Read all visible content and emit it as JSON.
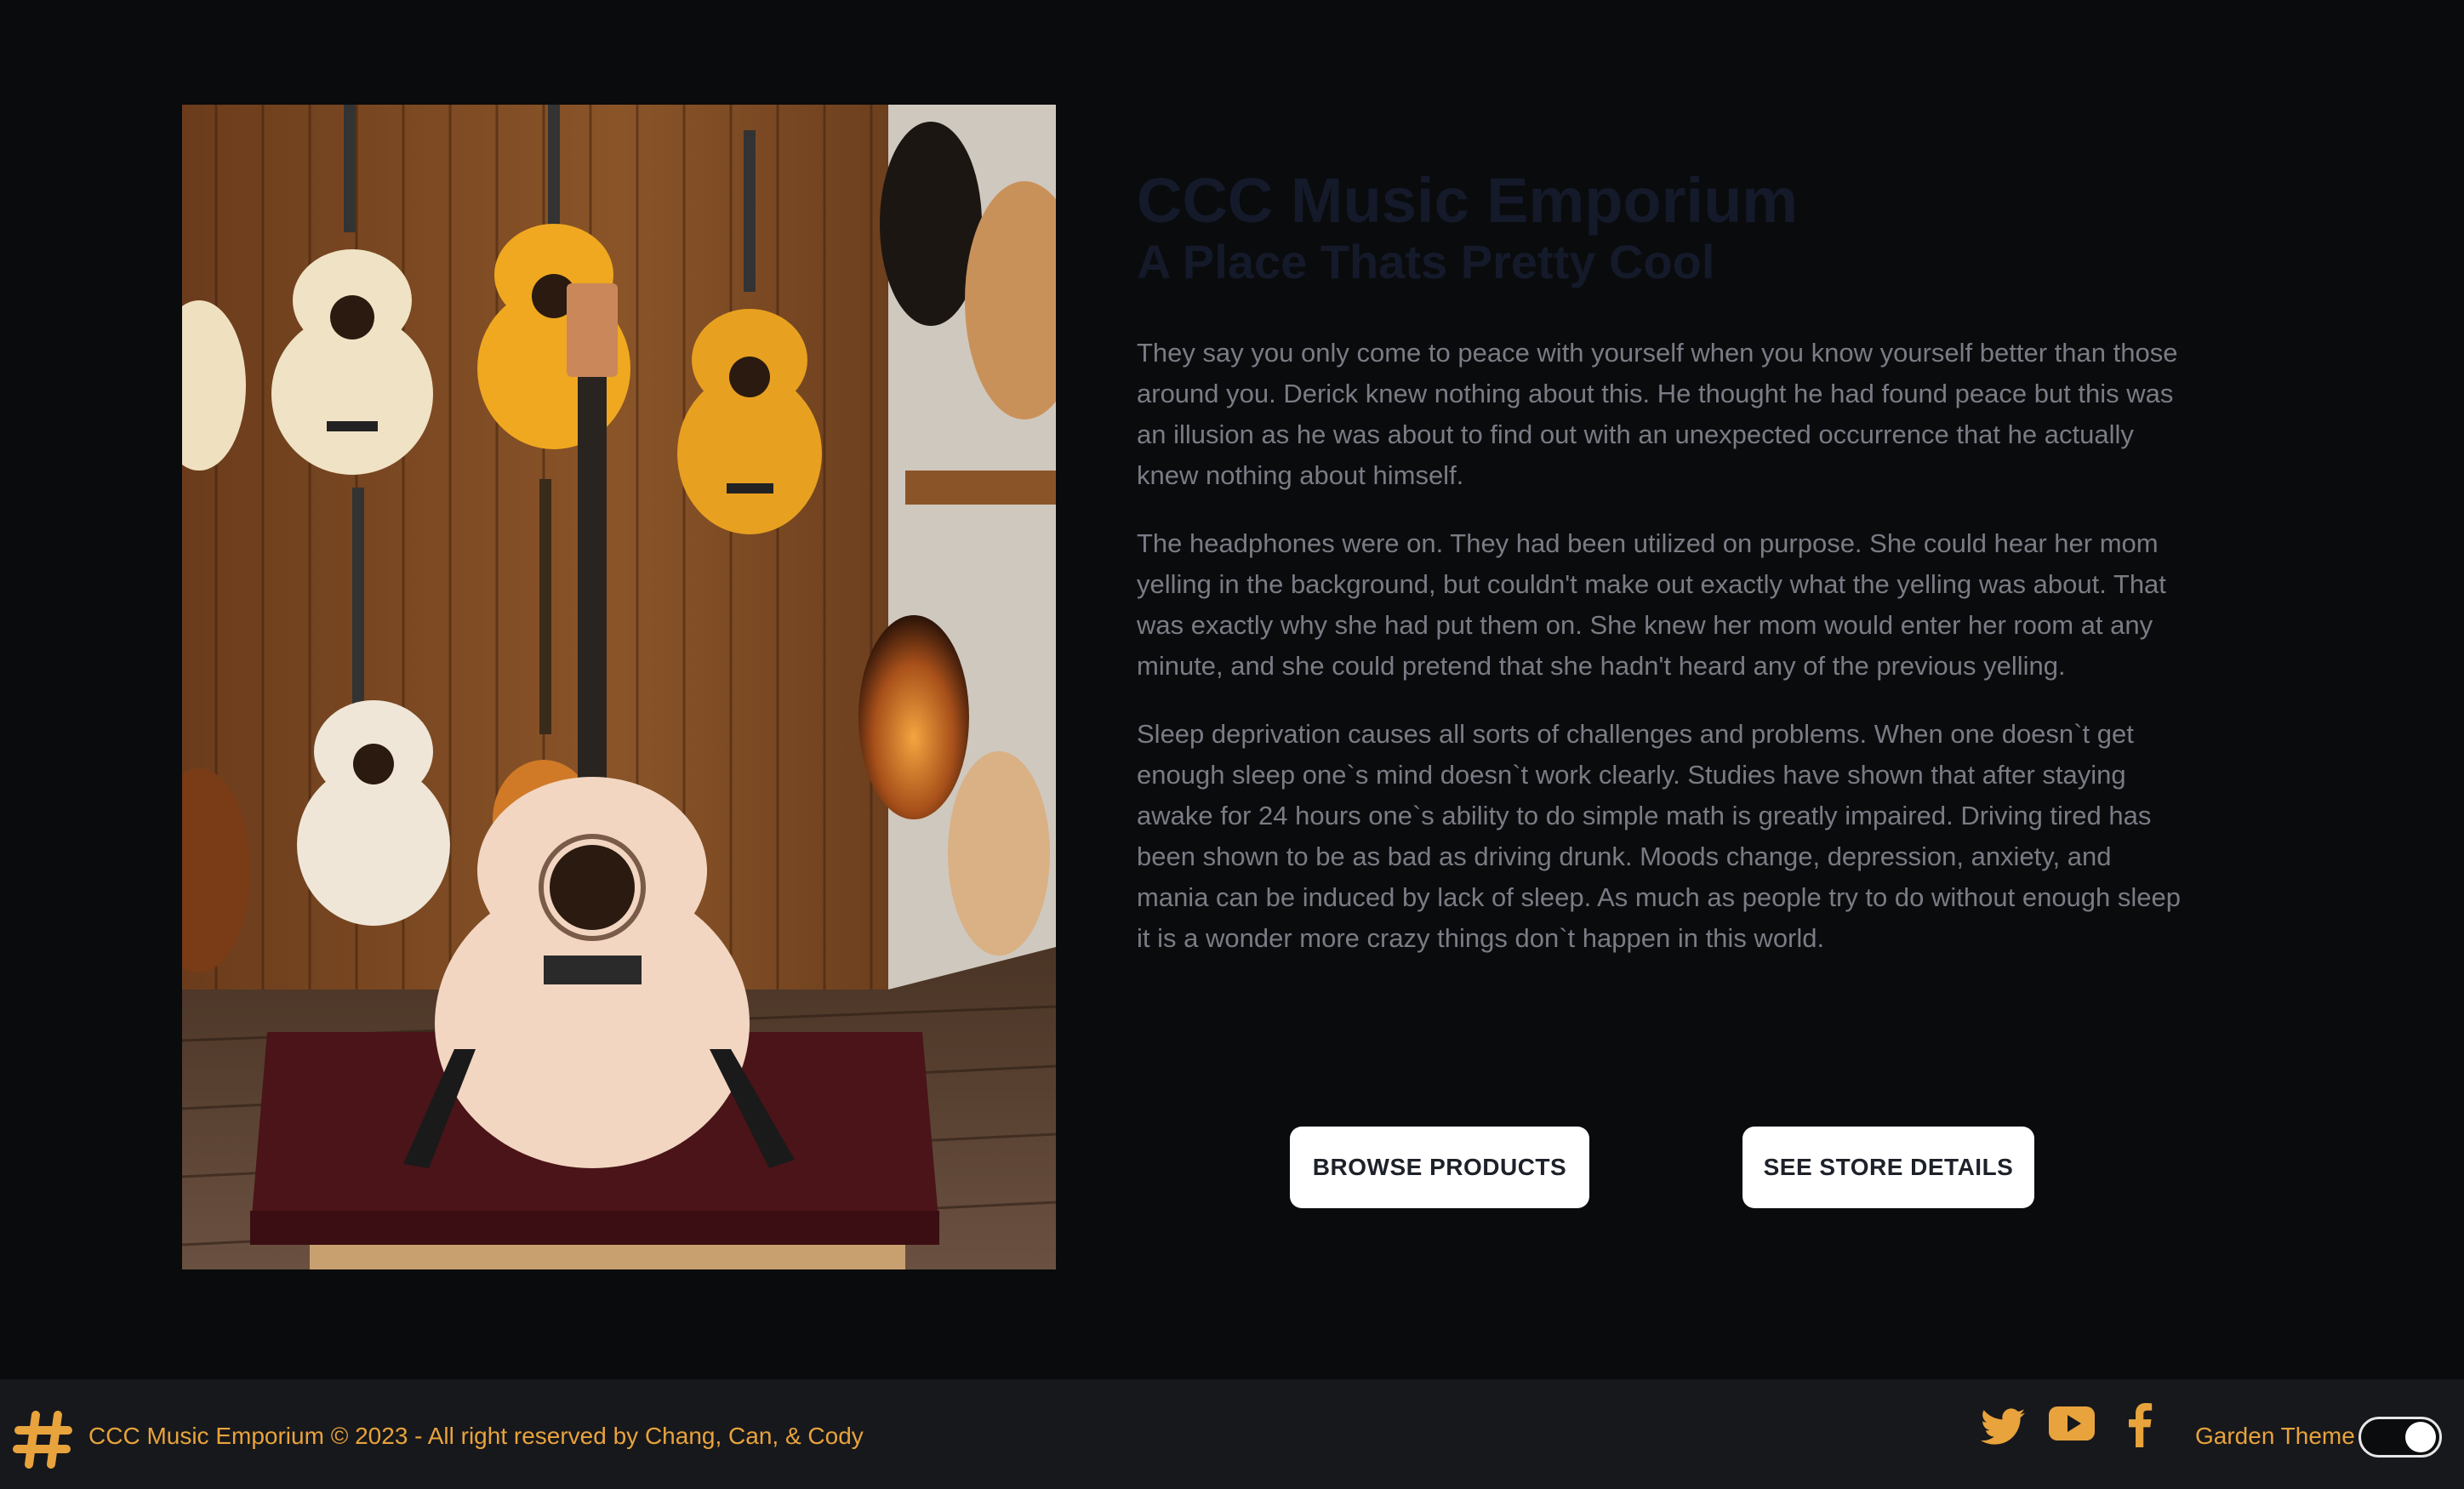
{
  "hero": {
    "title": "CCC Music Emporium",
    "subtitle": "A Place Thats Pretty Cool",
    "paragraphs": [
      "They say you only come to peace with yourself when you know yourself better than those around you. Derick knew nothing about this. He thought he had found peace but this was an illusion as he was about to find out with an unexpected occurrence that he actually knew nothing about himself.",
      "The headphones were on. They had been utilized on purpose. She could hear her mom yelling in the background, but couldn't make out exactly what the yelling was about. That was exactly why she had put them on. She knew her mom would enter her room at any minute, and she could pretend that she hadn't heard any of the previous yelling.",
      "Sleep deprivation causes all sorts of challenges and problems. When one doesn`t get enough sleep one`s mind doesn`t work clearly. Studies have shown that after staying awake for 24 hours one`s ability to do simple math is greatly impaired. Driving tired has been shown to be as bad as driving drunk. Moods change, depression, anxiety, and mania can be induced by lack of sleep. As much as people try to do without enough sleep it is a wonder more crazy things don`t happen in this world."
    ],
    "buttons": {
      "browse": "BROWSE PRODUCTS",
      "store": "SEE STORE DETAILS"
    }
  },
  "footer": {
    "copyright": "CCC Music Emporium © 2023 - All right reserved by Chang, Can, & Cody",
    "theme_label": "Garden Theme",
    "icons": [
      "hash-logo-icon",
      "twitter-icon",
      "youtube-icon",
      "facebook-icon"
    ],
    "theme_toggle_on": true
  },
  "colors": {
    "background": "#0a0b0d",
    "footer_bg": "#17181b",
    "accent": "#e8a33d",
    "title": "#141a2a",
    "body_text": "#7a7b84",
    "button_bg": "#ffffff"
  }
}
